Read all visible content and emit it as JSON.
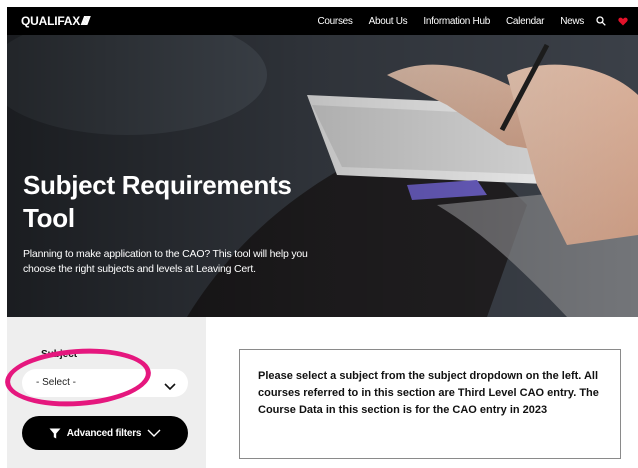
{
  "brand": {
    "logo_text": "QUALIFAX",
    "logo_mark": "/////"
  },
  "nav": {
    "items": [
      {
        "label": "Courses"
      },
      {
        "label": "About Us"
      },
      {
        "label": "Information Hub"
      },
      {
        "label": "Calendar"
      },
      {
        "label": "News"
      }
    ],
    "icons": [
      "search-icon",
      "heart-icon"
    ],
    "heart_color": "#e3122a"
  },
  "hero": {
    "title": "Subject Requirements Tool",
    "subtitle": "Planning to make application to the CAO? This tool will help you choose the right subjects and levels at Leaving Cert."
  },
  "filters": {
    "subject_label": "Subject",
    "subject_select_value": "- Select -",
    "advanced_button_label": "Advanced filters",
    "highlight_color": "#e5177e"
  },
  "info": {
    "message": "Please select a subject from the subject dropdown on the left. All courses referred to in this section are Third Level CAO entry. The Course Data in this section is for the CAO entry in 2023"
  }
}
